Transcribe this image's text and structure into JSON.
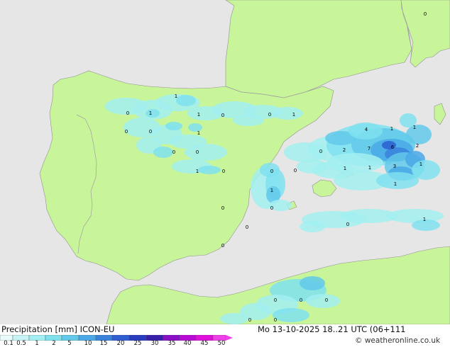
{
  "footer": {
    "title": "Precipitation [mm]  ICON-EU",
    "time": "Mo 13-10-2025 18..21 UTC (06+111",
    "credit": "© weatheronline.co.uk"
  },
  "legend": {
    "ticks": [
      "0.1",
      "0.5",
      "1",
      "2",
      "5",
      "10",
      "15",
      "20",
      "25",
      "30",
      "35",
      "40",
      "45",
      "50"
    ],
    "colors": [
      "#e9fbfb",
      "#c6f4f4",
      "#a2eef0",
      "#7fe0ee",
      "#62c9ea",
      "#4aa8e6",
      "#3a82dc",
      "#2e5ed0",
      "#2a3cc0",
      "#3a20a8",
      "#8a10c8",
      "#b80cd6",
      "#e010dc",
      "#f040e8"
    ]
  },
  "map": {
    "sea_color": "#e6e6e6",
    "land_color": "#c8f59a",
    "border_color": "#a0a0a0",
    "labels": [
      {
        "t": "1"
      },
      {
        "t": "0"
      },
      {
        "t": "1"
      },
      {
        "t": "1"
      },
      {
        "t": "0"
      },
      {
        "t": "0"
      },
      {
        "t": "1"
      },
      {
        "t": "0"
      },
      {
        "t": "0"
      },
      {
        "t": "1"
      },
      {
        "t": "0"
      },
      {
        "t": "0"
      },
      {
        "t": "1"
      },
      {
        "t": "0"
      },
      {
        "t": "0"
      },
      {
        "t": "0"
      },
      {
        "t": "2"
      },
      {
        "t": "4"
      },
      {
        "t": "1"
      },
      {
        "t": "1"
      },
      {
        "t": "7"
      },
      {
        "t": "6"
      },
      {
        "t": "2"
      },
      {
        "t": "0"
      },
      {
        "t": "1"
      },
      {
        "t": "1"
      },
      {
        "t": "1"
      },
      {
        "t": "3"
      },
      {
        "t": "1"
      },
      {
        "t": "1"
      },
      {
        "t": "0"
      },
      {
        "t": "0"
      },
      {
        "t": "0"
      },
      {
        "t": "0"
      },
      {
        "t": "1"
      },
      {
        "t": "0"
      },
      {
        "t": "0"
      },
      {
        "t": "0"
      },
      {
        "t": "0"
      },
      {
        "t": "0"
      },
      {
        "t": "0"
      },
      {
        "t": "0"
      }
    ]
  }
}
